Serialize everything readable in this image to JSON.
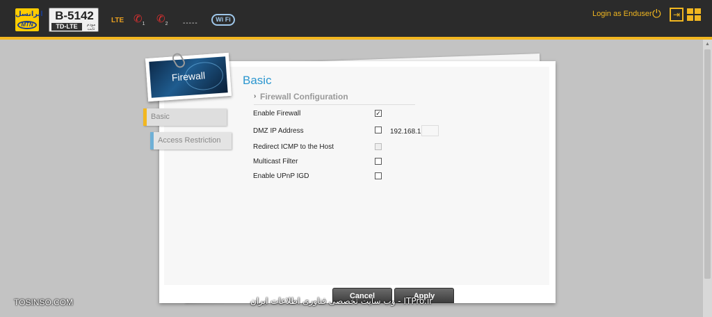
{
  "header": {
    "brand_fa": "ایرانسل",
    "brand_en": "MTN",
    "model": "B-5142",
    "technology": "TD-LTE",
    "model_sub": "مودم ثابت",
    "network_type": "LTE",
    "phone_lines": [
      "1",
      "2"
    ],
    "phone_icon": "phone-blocked-icon",
    "signal_placeholder": "-----",
    "wifi_label": "Wi Fi",
    "login_text": "Login as Enduser",
    "accent_color": "#f2b720"
  },
  "sidebar": {
    "badge_title": "Firewall",
    "tabs": [
      {
        "label": "Basic",
        "active": true
      },
      {
        "label": "Access Restriction",
        "active": false
      }
    ]
  },
  "main": {
    "title": "Basic",
    "section_title": "Firewall Configuration",
    "rows": [
      {
        "label": "Enable Firewall",
        "checked": true,
        "disabled": false
      },
      {
        "label": "DMZ IP Address",
        "checked": false,
        "disabled": false
      },
      {
        "label": "Redirect ICMP to the Host",
        "checked": false,
        "disabled": true
      },
      {
        "label": "Multicast Filter",
        "checked": false,
        "disabled": false
      },
      {
        "label": "Enable UPnP IGD",
        "checked": false,
        "disabled": false
      }
    ],
    "dmz_ip_prefix": "192.168.1.",
    "dmz_ip_last": ""
  },
  "buttons": {
    "cancel": "Cancel",
    "apply": "Apply"
  },
  "watermarks": {
    "left": "TOSINSO.COM",
    "center": "ITPro.ir - وب سایت تخصصی فناوری اطلاعات ایران"
  }
}
